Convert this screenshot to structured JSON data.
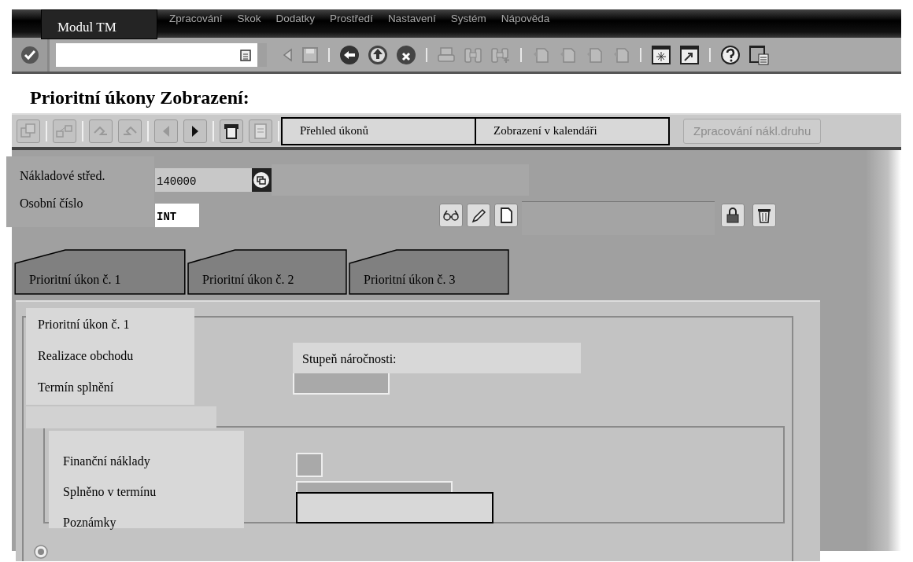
{
  "menu_bar": {
    "module": "Modul TM",
    "items": [
      "Zpracování",
      "Skok",
      "Dodatky",
      "Prostředí",
      "Nastavení",
      "Systém",
      "Nápověda"
    ]
  },
  "title": "Prioritní úkony Zobrazení:",
  "app_toolbar": {
    "buttons": [
      {
        "label": "Přehled úkonů",
        "disabled": false
      },
      {
        "label": "Zobrazení v kalendáři",
        "disabled": false
      },
      {
        "label": "Zpracování nákl.druhu",
        "disabled": true
      }
    ]
  },
  "header_fields": [
    {
      "label": "Nákladové střed.",
      "value": "140000"
    },
    {
      "label": "Osobní číslo",
      "value": "INT"
    }
  ],
  "tabs": [
    {
      "label": "Prioritní úkon č. 1"
    },
    {
      "label": "Prioritní úkon č. 2"
    },
    {
      "label": "Prioritní úkon č. 3"
    }
  ],
  "group_1": {
    "title": "Prioritní úkon č. 1",
    "labels": [
      "Realizace obchodu",
      "Termín splnění"
    ],
    "side_label": "Stupeň náročnosti:"
  },
  "group_2": {
    "labels": [
      "Finanční náklady",
      "Splněno v termínu",
      "Poznámky"
    ]
  }
}
